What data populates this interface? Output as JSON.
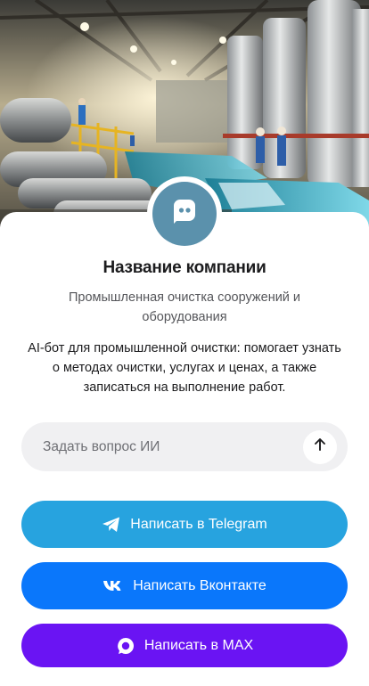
{
  "company": {
    "name": "Название компании",
    "subtitle": "Промышленная очистка сооружений и оборудования",
    "description": "AI-бот для промышленной очистки: помогает узнать о методах очистки, услугах и ценах, а также записаться на выполнение работ."
  },
  "hero": {
    "icon": "industrial-plant-image"
  },
  "avatar": {
    "icon": "chat-bot-icon",
    "color": "#5b91ac"
  },
  "ask": {
    "placeholder": "Задать вопрос ИИ",
    "value": "",
    "send_icon": "arrow-up-icon"
  },
  "buttons": {
    "telegram": {
      "label": "Написать в Telegram",
      "icon": "telegram-icon",
      "color": "#27a3df"
    },
    "vk": {
      "label": "Написать Вконтакте",
      "icon": "vk-icon",
      "color": "#0a77fb"
    },
    "max": {
      "label": "Написать в MAX",
      "icon": "max-icon",
      "color": "#6a14f3"
    }
  }
}
